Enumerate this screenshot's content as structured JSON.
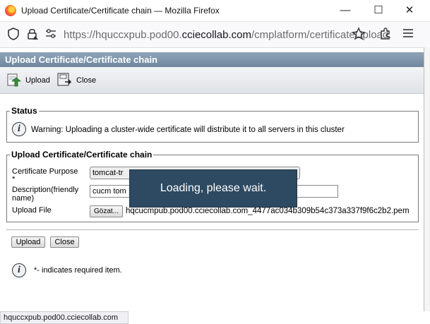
{
  "window": {
    "title": "Upload Certificate/Certificate chain — Mozilla Firefox",
    "minimize": "—",
    "maximize": "☐",
    "close": "✕"
  },
  "urlbar": {
    "scheme_prefix": "https://hquccxpub.pod00.",
    "domain": "cciecollab.com",
    "path": "/cmplatform/certificateUpload."
  },
  "dialog": {
    "title": "Upload Certificate/Certificate chain",
    "toolbar": {
      "upload_label": "Upload",
      "close_label": "Close"
    },
    "status": {
      "legend": "Status",
      "message": "Warning: Uploading a cluster-wide certificate will distribute it to all servers in this cluster"
    },
    "upload_section": {
      "legend": "Upload Certificate/Certificate chain",
      "purpose_label": "Certificate Purpose",
      "purpose_required": "*",
      "purpose_value": "tomcat-tr",
      "description_label_line1": "Description(friendly",
      "description_label_line2": "name)",
      "description_value": "cucm tom",
      "file_label": "Upload File",
      "browse_button": "Gözat...",
      "file_name": "hqcucmpub.pod00.cciecollab.com_4477ac034b309b54c373a337f9f6c2b2.pem"
    },
    "buttons": {
      "upload": "Upload",
      "close": "Close"
    },
    "required_note": "*- indicates required item.",
    "loading": "Loading, please wait."
  },
  "statusbar": {
    "text": "hquccxpub.pod00.cciecollab.com"
  }
}
